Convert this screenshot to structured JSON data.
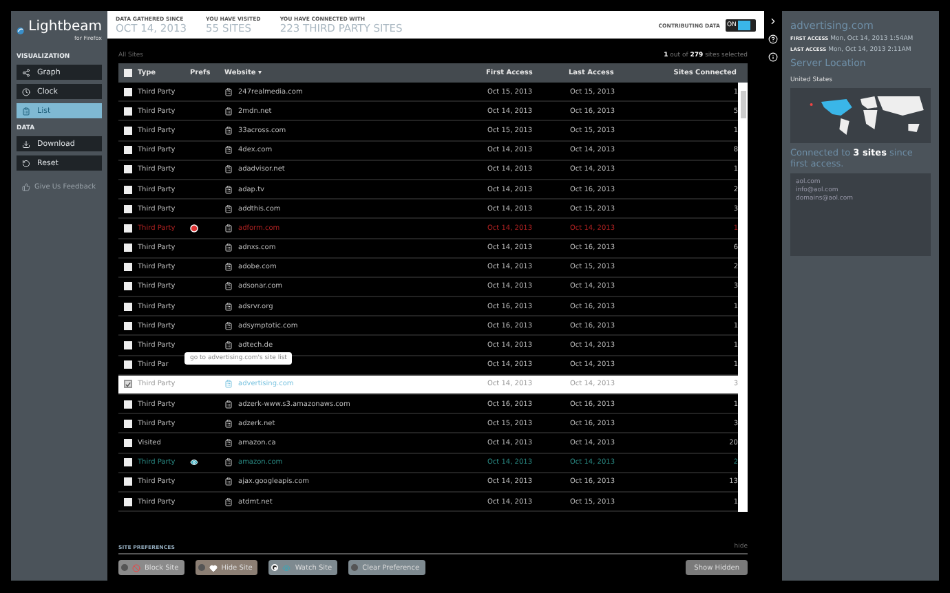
{
  "sidebar": {
    "logo": "Lightbeam",
    "logo_sub": "for Firefox",
    "sections": [
      {
        "title": "VISUALIZATION",
        "items": [
          {
            "kind": "graph",
            "label": "Graph",
            "selected": false
          },
          {
            "kind": "clock",
            "label": "Clock",
            "selected": false
          },
          {
            "kind": "list",
            "label": "List",
            "selected": true
          }
        ]
      },
      {
        "title": "DATA",
        "items": [
          {
            "kind": "download",
            "label": "Download",
            "selected": false
          },
          {
            "kind": "reset",
            "label": "Reset",
            "selected": false
          }
        ]
      }
    ],
    "feedback": "Give Us Feedback"
  },
  "header": {
    "stats": [
      {
        "label": "DATA GATHERED SINCE",
        "value": "OCT 14, 2013"
      },
      {
        "label": "YOU HAVE VISITED",
        "value": "55 SITES"
      },
      {
        "label": "YOU HAVE CONNECTED WITH",
        "value": "223 THIRD PARTY SITES"
      }
    ],
    "contributing": {
      "label": "CONTRIBUTING DATA",
      "toggle": "ON",
      "on": true
    }
  },
  "list": {
    "breadcrumb": "All Sites",
    "all_checked": false,
    "selection": "**1** out of **279** sites selected",
    "columns": [
      "Type",
      "Prefs",
      "Website ▾",
      "First Access",
      "Last Access",
      "Sites Connected"
    ],
    "rows": [
      {
        "type": "Third Party",
        "blocked": false,
        "watched": false,
        "website": "247realmedia.com",
        "first": "Oct 15, 2013",
        "last": "Oct 15, 2013",
        "sites": "1",
        "checked": false
      },
      {
        "type": "Third Party",
        "blocked": false,
        "watched": false,
        "website": "2mdn.net",
        "first": "Oct 14, 2013",
        "last": "Oct 16, 2013",
        "sites": "5",
        "checked": false
      },
      {
        "type": "Third Party",
        "blocked": false,
        "watched": false,
        "website": "33across.com",
        "first": "Oct 15, 2013",
        "last": "Oct 15, 2013",
        "sites": "1",
        "checked": false
      },
      {
        "type": "Third Party",
        "blocked": false,
        "watched": false,
        "website": "4dex.com",
        "first": "Oct 14, 2013",
        "last": "Oct 14, 2013",
        "sites": "8",
        "checked": false
      },
      {
        "type": "Third Party",
        "blocked": false,
        "watched": false,
        "website": "adadvisor.net",
        "first": "Oct 14, 2013",
        "last": "Oct 14, 2013",
        "sites": "1",
        "checked": false
      },
      {
        "type": "Third Party",
        "blocked": false,
        "watched": false,
        "website": "adap.tv",
        "first": "Oct 14, 2013",
        "last": "Oct 16, 2013",
        "sites": "2",
        "checked": false
      },
      {
        "type": "Third Party",
        "blocked": false,
        "watched": false,
        "website": "addthis.com",
        "first": "Oct 14, 2013",
        "last": "Oct 15, 2013",
        "sites": "3",
        "checked": false
      },
      {
        "type": "Third Party",
        "blocked": true,
        "watched": false,
        "website": "adform.com",
        "first": "Oct 14, 2013",
        "last": "Oct 14, 2013",
        "sites": "1",
        "checked": false
      },
      {
        "type": "Third Party",
        "blocked": false,
        "watched": false,
        "website": "adnxs.com",
        "first": "Oct 14, 2013",
        "last": "Oct 16, 2013",
        "sites": "6",
        "checked": false
      },
      {
        "type": "Third Party",
        "blocked": false,
        "watched": false,
        "website": "adobe.com",
        "first": "Oct 14, 2013",
        "last": "Oct 15, 2013",
        "sites": "2",
        "checked": false
      },
      {
        "type": "Third Party",
        "blocked": false,
        "watched": false,
        "website": "adsonar.com",
        "first": "Oct 14, 2013",
        "last": "Oct 14, 2013",
        "sites": "3",
        "checked": false
      },
      {
        "type": "Third Party",
        "blocked": false,
        "watched": false,
        "website": "adsrvr.org",
        "first": "Oct 16, 2013",
        "last": "Oct 16, 2013",
        "sites": "1",
        "checked": false
      },
      {
        "type": "Third Party",
        "blocked": false,
        "watched": false,
        "website": "adsymptotic.com",
        "first": "Oct 16, 2013",
        "last": "Oct 16, 2013",
        "sites": "1",
        "checked": false
      },
      {
        "type": "Third Party",
        "blocked": false,
        "watched": false,
        "website": "adtech.de",
        "first": "Oct 14, 2013",
        "last": "Oct 14, 2013",
        "sites": "1",
        "checked": false
      },
      {
        "type": "Third Par",
        "blocked": false,
        "watched": false,
        "tooltip": "go to advertising.com's site list",
        "first": "Oct 14, 2013",
        "last": "Oct 14, 2013",
        "sites": "1",
        "checked": false
      },
      {
        "type": "Third Party",
        "blocked": false,
        "watched": false,
        "website": "advertising.com",
        "first": "Oct 14, 2013",
        "last": "Oct 14, 2013",
        "sites": "3",
        "checked": true
      },
      {
        "type": "Third Party",
        "blocked": false,
        "watched": false,
        "website": "adzerk-www.s3.amazonaws.com",
        "first": "Oct 16, 2013",
        "last": "Oct 16, 2013",
        "sites": "1",
        "checked": false
      },
      {
        "type": "Third Party",
        "blocked": false,
        "watched": false,
        "website": "adzerk.net",
        "first": "Oct 15, 2013",
        "last": "Oct 16, 2013",
        "sites": "3",
        "checked": false
      },
      {
        "type": "Visited",
        "blocked": false,
        "watched": false,
        "website": "amazon.ca",
        "first": "Oct 14, 2013",
        "last": "Oct 14, 2013",
        "sites": "20",
        "checked": false
      },
      {
        "type": "Third Party",
        "blocked": false,
        "watched": true,
        "website": "amazon.com",
        "first": "Oct 14, 2013",
        "last": "Oct 14, 2013",
        "sites": "2",
        "checked": false
      },
      {
        "type": "Third Party",
        "blocked": false,
        "watched": false,
        "website": "ajax.googleapis.com",
        "first": "Oct 14, 2013",
        "last": "Oct 16, 2013",
        "sites": "13",
        "checked": false
      },
      {
        "type": "Third Party",
        "blocked": false,
        "watched": false,
        "website": "atdmt.net",
        "first": "Oct 14, 2013",
        "last": "Oct 15, 2013",
        "sites": "1",
        "checked": false
      }
    ]
  },
  "preferences": {
    "title": "SITE PREFERENCES",
    "hide": "hide",
    "buttons": [
      {
        "kind": "block",
        "label": "Block Site",
        "selected": false
      },
      {
        "kind": "hide",
        "label": "Hide Site",
        "selected": false
      },
      {
        "kind": "watch",
        "label": "Watch Site",
        "selected": true
      },
      {
        "kind": "clear",
        "label": "Clear Preference",
        "selected": false
      }
    ],
    "show_hidden": "Show Hidden"
  },
  "detail": {
    "title": "advertising.com",
    "first_label": "FIRST ACCESS",
    "first": "Mon, Oct 14, 2013 1:54AM",
    "last_label": "LAST ACCESS",
    "last": "Mon, Oct 14, 2013 2:11AM",
    "location_title": "Server Location",
    "country": "United States",
    "connected": "Connected to **3 sites** since first access.",
    "contacts": [
      "aol.com",
      "info@aol.com",
      "domains@aol.com"
    ]
  }
}
